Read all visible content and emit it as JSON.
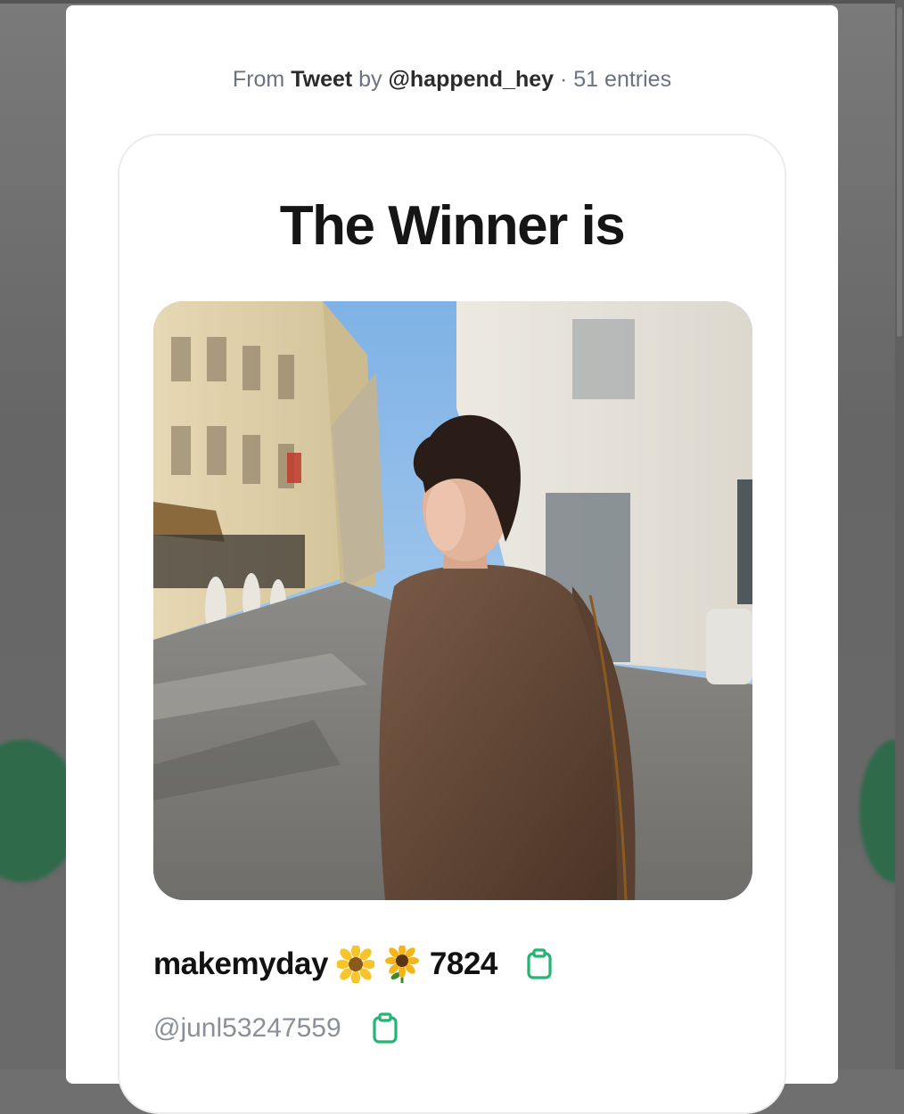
{
  "header": {
    "from_label": "From",
    "source_type": "Tweet",
    "by_label": "by",
    "author": "@happend_hey",
    "separator": "·",
    "entries": "51 entries"
  },
  "result": {
    "title": "The Winner is",
    "winner_name_prefix": "makemyday",
    "winner_name_suffix": "7824",
    "winner_handle": "@junl53247559"
  },
  "icons": {
    "copy_name": "clipboard-icon",
    "copy_handle": "clipboard-icon",
    "flower": "sunflower-icon"
  },
  "colors": {
    "accent_green": "#22b573",
    "muted_text": "#6b7280",
    "handle_text": "#8a8f98"
  }
}
